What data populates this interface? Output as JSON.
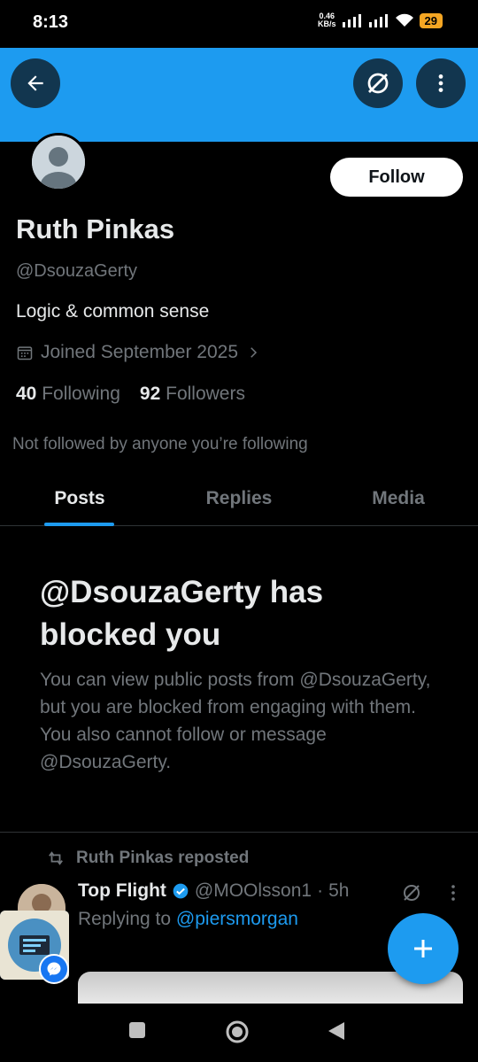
{
  "status_bar": {
    "time": "8:13",
    "net_speed_value": "0.46",
    "net_speed_unit": "KB/s",
    "battery": "29"
  },
  "profile": {
    "display_name": "Ruth Pinkas",
    "handle": "@DsouzaGerty",
    "bio": "Logic & common sense",
    "joined": "Joined September 2025",
    "following_count": "40",
    "following_label": "Following",
    "followers_count": "92",
    "followers_label": "Followers",
    "not_followed_text": "Not followed by anyone you’re following",
    "follow_button": "Follow"
  },
  "tabs": [
    {
      "label": "Posts",
      "active": true
    },
    {
      "label": "Replies",
      "active": false
    },
    {
      "label": "Media",
      "active": false
    }
  ],
  "blocked": {
    "title": "@DsouzaGerty has blocked you",
    "body": "You can view public posts from @DsouzaGerty, but you are blocked from engaging with them. You also cannot follow or message @DsouzaGerty."
  },
  "post": {
    "repost_label": "Ruth Pinkas reposted",
    "author_name": "Top Flight",
    "author_handle": "@MOOlsson1",
    "separator": "·",
    "time": "5h",
    "replying_prefix": "Replying to",
    "replying_to": "@piersmorgan"
  },
  "colors": {
    "accent": "#1d9bf0",
    "background": "#000000",
    "text_primary": "#e7e9ea",
    "text_secondary": "#71767b"
  }
}
